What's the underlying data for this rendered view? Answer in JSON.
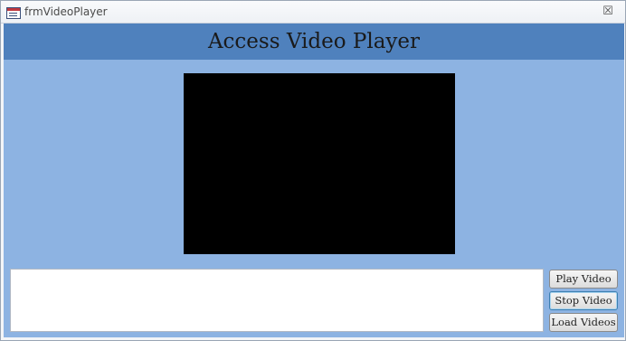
{
  "window": {
    "title": "frmVideoPlayer",
    "close_glyph": "☒",
    "form_icon": "form-icon"
  },
  "header": {
    "title": "Access Video Player",
    "color": "#4f81bd"
  },
  "detail": {
    "background_color": "#8db3e2",
    "video_color": "#000000",
    "text_box_value": ""
  },
  "buttons": {
    "play_label": "Play Video",
    "stop_label": "Stop Video",
    "load_label": "Load Videos"
  }
}
